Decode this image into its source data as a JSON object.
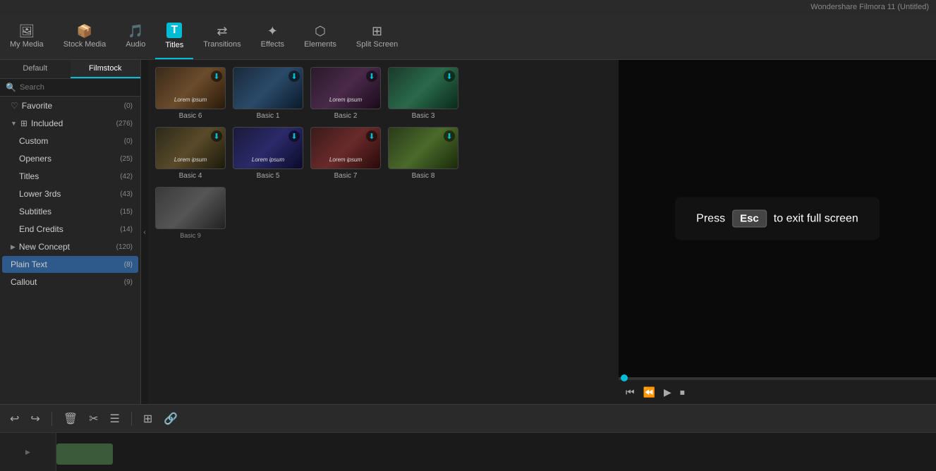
{
  "app": {
    "title": "Wondershare Filmora 11 (Untitled)"
  },
  "nav": {
    "items": [
      {
        "id": "my-media",
        "label": "My Media",
        "icon": "🖼"
      },
      {
        "id": "stock-media",
        "label": "Stock Media",
        "icon": "📦"
      },
      {
        "id": "audio",
        "label": "Audio",
        "icon": "🎵"
      },
      {
        "id": "titles",
        "label": "Titles",
        "icon": "T",
        "active": true
      },
      {
        "id": "transitions",
        "label": "Transitions",
        "icon": "⋈"
      },
      {
        "id": "effects",
        "label": "Effects",
        "icon": "✦"
      },
      {
        "id": "elements",
        "label": "Elements",
        "icon": "⬡"
      },
      {
        "id": "split-screen",
        "label": "Split Screen",
        "icon": "⊞"
      }
    ]
  },
  "sidebar": {
    "tabs": [
      {
        "id": "default",
        "label": "Default",
        "active": false
      },
      {
        "id": "filmstock",
        "label": "Filmstock",
        "active": true
      }
    ],
    "search_placeholder": "Search",
    "items": [
      {
        "id": "favorite",
        "label": "Favorite",
        "count": "0",
        "icon": "♡",
        "indent": 0
      },
      {
        "id": "included",
        "label": "Included",
        "count": "276",
        "icon": "▼",
        "indent": 0,
        "expanded": true,
        "active": false
      },
      {
        "id": "custom",
        "label": "Custom",
        "count": "0",
        "indent": 1
      },
      {
        "id": "openers",
        "label": "Openers",
        "count": "25",
        "indent": 1
      },
      {
        "id": "titles",
        "label": "Titles",
        "count": "42",
        "indent": 1
      },
      {
        "id": "lower-3rds",
        "label": "Lower 3rds",
        "count": "43",
        "indent": 1
      },
      {
        "id": "subtitles",
        "label": "Subtitles",
        "count": "15",
        "indent": 1
      },
      {
        "id": "end-credits",
        "label": "End Credits",
        "count": "14",
        "indent": 1
      },
      {
        "id": "new-concept",
        "label": "New Concept",
        "count": "120",
        "indent": 0,
        "expandable": true
      },
      {
        "id": "plain-text",
        "label": "Plain Text",
        "count": "8",
        "indent": 0,
        "active": true
      },
      {
        "id": "callout",
        "label": "Callout",
        "count": "9",
        "indent": 0
      }
    ]
  },
  "content": {
    "thumbnails": [
      {
        "id": "basic6",
        "label": "Basic 6",
        "class": "basic6",
        "has_lorem": true,
        "has_download": true
      },
      {
        "id": "basic1",
        "label": "Basic 1",
        "class": "basic1",
        "has_lorem": false,
        "has_download": true
      },
      {
        "id": "basic2",
        "label": "Basic 2",
        "class": "basic2",
        "has_lorem": true,
        "has_download": true
      },
      {
        "id": "basic3",
        "label": "Basic 3",
        "class": "basic3",
        "has_lorem": false,
        "has_download": true
      },
      {
        "id": "basic4",
        "label": "Basic 4",
        "class": "basic4",
        "has_lorem": true,
        "has_download": true
      },
      {
        "id": "basic5",
        "label": "Basic 5",
        "class": "basic5",
        "has_lorem": true,
        "has_download": true
      },
      {
        "id": "basic7",
        "label": "Basic 7",
        "class": "basic7",
        "has_lorem": true,
        "has_download": true
      },
      {
        "id": "basic8",
        "label": "Basic 8",
        "class": "basic8",
        "has_lorem": false,
        "has_download": true
      },
      {
        "id": "basic9",
        "label": "Basic 9",
        "class": "basic9",
        "has_lorem": false,
        "has_download": false
      }
    ]
  },
  "overlay": {
    "press_label": "Press",
    "esc_label": "Esc",
    "message": "to exit full screen"
  },
  "playback": {
    "controls": [
      {
        "id": "prev-frame",
        "icon": "⏮"
      },
      {
        "id": "step-back",
        "icon": "⏪"
      },
      {
        "id": "play",
        "icon": "▶"
      },
      {
        "id": "stop",
        "icon": "⏹"
      }
    ]
  },
  "bottom_toolbar": {
    "buttons": [
      {
        "id": "undo",
        "icon": "↩"
      },
      {
        "id": "redo",
        "icon": "↪"
      },
      {
        "id": "delete",
        "icon": "🗑"
      },
      {
        "id": "cut",
        "icon": "✂"
      },
      {
        "id": "more",
        "icon": "☰"
      },
      {
        "id": "add-to-timeline",
        "icon": "⊞"
      },
      {
        "id": "link",
        "icon": "🔗"
      }
    ]
  },
  "colors": {
    "accent": "#00bcd4",
    "active_bg": "#2d5a8a",
    "bg_dark": "#1a1a1a",
    "bg_panel": "#252525",
    "bg_content": "#1e1e1e"
  }
}
